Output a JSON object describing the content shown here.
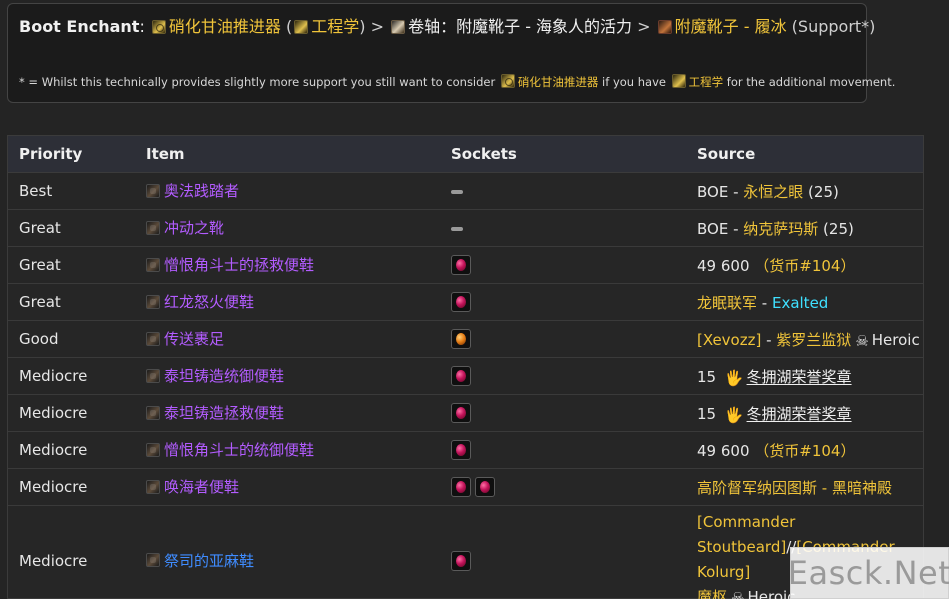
{
  "enchant": {
    "label": "Boot Enchant",
    "colon": ":",
    "enchant_1": "硝化甘油推进器",
    "paren_open": " (",
    "profession": "工程学",
    "paren_close": ") > ",
    "scroll_text": "卷轴：附魔靴子 - 海象人的活力",
    "arrow": " > ",
    "enchant_2": "附魔靴子 - 履冰",
    "support": " (Support*)"
  },
  "note": {
    "prefix": "* = Whilst this technically provides slightly more support you still want to consider ",
    "enchant_1": "硝化甘油推进器",
    "middle": " if you have ",
    "profession": "工程学",
    "suffix": " for the additional movement."
  },
  "table": {
    "headers": [
      "Priority",
      "Item",
      "Sockets",
      "Source"
    ],
    "rows": [
      {
        "priority": "Best",
        "item": "奥法践踏者",
        "item_color": "purple",
        "sockets": "dash",
        "source": {
          "prefix": "BOE - ",
          "gold": "永恒之眼",
          "suffix": " (25)"
        }
      },
      {
        "priority": "Great",
        "item": "冲动之靴",
        "item_color": "purple",
        "sockets": "dash",
        "source": {
          "prefix": "BOE - ",
          "gold": "纳克萨玛斯",
          "suffix": " (25)"
        }
      },
      {
        "priority": "Great",
        "item": "憎恨角斗士的拯救便鞋",
        "item_color": "purple",
        "sockets": "red",
        "source": {
          "prefix": "49 600 ",
          "gold": "（货币#104）",
          "suffix": ""
        }
      },
      {
        "priority": "Great",
        "item": "红龙怒火便鞋",
        "item_color": "purple",
        "sockets": "red",
        "source": {
          "gold": "龙眠联军",
          "dash": " - ",
          "cyan": "Exalted"
        }
      },
      {
        "priority": "Good",
        "item": "传送裹足",
        "item_color": "purple",
        "sockets": "orange",
        "source": {
          "gold": "[Xevozz]",
          "dash": " - ",
          "gold2": "紫罗兰监狱",
          "heroic": "Heroic"
        }
      },
      {
        "priority": "Mediocre",
        "item": "泰坦铸造统御便鞋",
        "item_color": "purple",
        "sockets": "red",
        "source": {
          "prefix": "15 ",
          "underline": "冬拥湖荣誉奖章"
        }
      },
      {
        "priority": "Mediocre",
        "item": "泰坦铸造拯救便鞋",
        "item_color": "purple",
        "sockets": "red",
        "source": {
          "prefix": "15 ",
          "underline": "冬拥湖荣誉奖章"
        }
      },
      {
        "priority": "Mediocre",
        "item": "憎恨角斗士的统御便鞋",
        "item_color": "purple",
        "sockets": "red",
        "source": {
          "prefix": "49 600 ",
          "gold": "（货币#104）",
          "suffix": ""
        }
      },
      {
        "priority": "Mediocre",
        "item": "唤海者便鞋",
        "item_color": "purple",
        "sockets": "red-red",
        "source": {
          "gold": "高阶督军纳因图斯",
          "dash": " - ",
          "gold2": "黑暗神殿"
        }
      },
      {
        "priority": "Mediocre",
        "item": "祭司的亚麻鞋",
        "item_color": "blue",
        "sockets": "red",
        "source": {
          "line1": "[Commander",
          "line2_a": "Stoutbeard]",
          "line2_sep": "//",
          "line2_b": "[Commander Kolurg]",
          "line3_a": "魔枢",
          "heroic": "Heroic"
        }
      }
    ]
  },
  "watermark": "Easck.Net"
}
